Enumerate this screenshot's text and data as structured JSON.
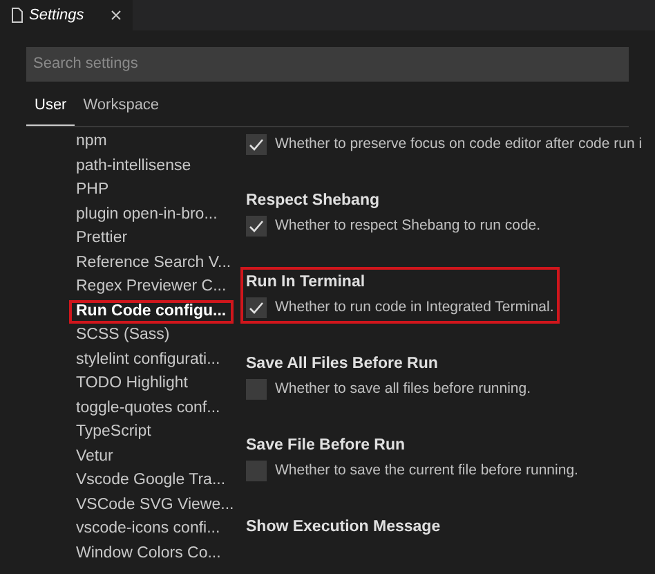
{
  "editor_tab": {
    "title": "Settings"
  },
  "search": {
    "placeholder": "Search settings"
  },
  "scope_tabs": [
    {
      "label": "User",
      "selected": true
    },
    {
      "label": "Workspace",
      "selected": false
    }
  ],
  "sidebar": {
    "items": [
      {
        "label": "npm",
        "selected": false,
        "highlighted": false
      },
      {
        "label": "path-intellisense",
        "selected": false,
        "highlighted": false
      },
      {
        "label": "PHP",
        "selected": false,
        "highlighted": false
      },
      {
        "label": "plugin open-in-bro...",
        "selected": false,
        "highlighted": false
      },
      {
        "label": "Prettier",
        "selected": false,
        "highlighted": false
      },
      {
        "label": "Reference Search V...",
        "selected": false,
        "highlighted": false
      },
      {
        "label": "Regex Previewer C...",
        "selected": false,
        "highlighted": false
      },
      {
        "label": "Run Code configu...",
        "selected": true,
        "highlighted": true
      },
      {
        "label": "SCSS (Sass)",
        "selected": false,
        "highlighted": false
      },
      {
        "label": "stylelint configurati...",
        "selected": false,
        "highlighted": false
      },
      {
        "label": "TODO Highlight",
        "selected": false,
        "highlighted": false
      },
      {
        "label": "toggle-quotes conf...",
        "selected": false,
        "highlighted": false
      },
      {
        "label": "TypeScript",
        "selected": false,
        "highlighted": false
      },
      {
        "label": "Vetur",
        "selected": false,
        "highlighted": false
      },
      {
        "label": "Vscode Google Tra...",
        "selected": false,
        "highlighted": false
      },
      {
        "label": "VSCode SVG Viewe...",
        "selected": false,
        "highlighted": false
      },
      {
        "label": "vscode-icons confi...",
        "selected": false,
        "highlighted": false
      },
      {
        "label": "Window Colors Co...",
        "selected": false,
        "highlighted": false
      }
    ]
  },
  "settings": [
    {
      "description": "Whether to preserve focus on code editor after code run i",
      "checked": true,
      "highlighted": false
    },
    {
      "title": "Respect Shebang",
      "description": "Whether to respect Shebang to run code.",
      "checked": true,
      "highlighted": false
    },
    {
      "title": "Run In Terminal",
      "description": "Whether to run code in Integrated Terminal.",
      "checked": true,
      "highlighted": true
    },
    {
      "title": "Save All Files Before Run",
      "description": "Whether to save all files before running.",
      "checked": false,
      "highlighted": false
    },
    {
      "title": "Save File Before Run",
      "description": "Whether to save the current file before running.",
      "checked": false,
      "highlighted": false
    },
    {
      "title": "Show Execution Message"
    }
  ]
}
